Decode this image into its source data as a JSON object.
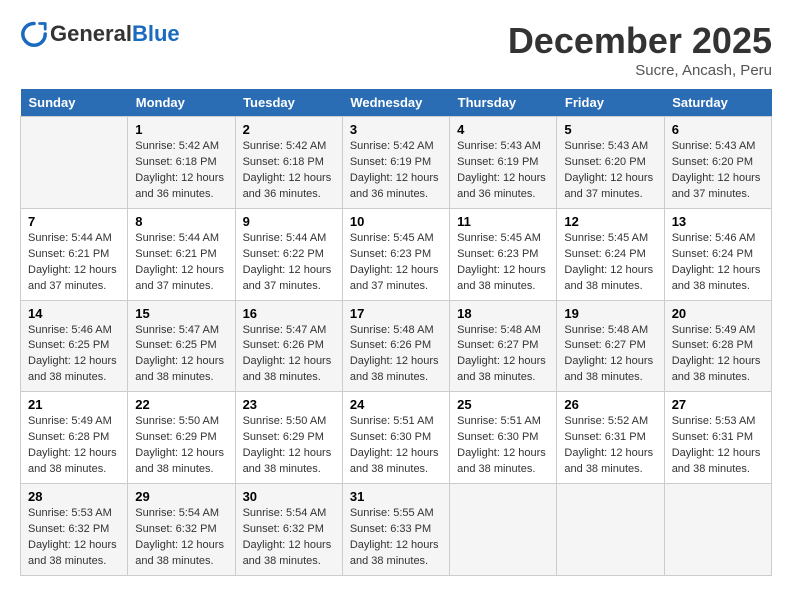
{
  "header": {
    "logo_line1": "General",
    "logo_line2": "Blue",
    "month_title": "December 2025",
    "location": "Sucre, Ancash, Peru"
  },
  "days_of_week": [
    "Sunday",
    "Monday",
    "Tuesday",
    "Wednesday",
    "Thursday",
    "Friday",
    "Saturday"
  ],
  "weeks": [
    [
      {
        "day": "",
        "info": ""
      },
      {
        "day": "1",
        "info": "Sunrise: 5:42 AM\nSunset: 6:18 PM\nDaylight: 12 hours\nand 36 minutes."
      },
      {
        "day": "2",
        "info": "Sunrise: 5:42 AM\nSunset: 6:18 PM\nDaylight: 12 hours\nand 36 minutes."
      },
      {
        "day": "3",
        "info": "Sunrise: 5:42 AM\nSunset: 6:19 PM\nDaylight: 12 hours\nand 36 minutes."
      },
      {
        "day": "4",
        "info": "Sunrise: 5:43 AM\nSunset: 6:19 PM\nDaylight: 12 hours\nand 36 minutes."
      },
      {
        "day": "5",
        "info": "Sunrise: 5:43 AM\nSunset: 6:20 PM\nDaylight: 12 hours\nand 37 minutes."
      },
      {
        "day": "6",
        "info": "Sunrise: 5:43 AM\nSunset: 6:20 PM\nDaylight: 12 hours\nand 37 minutes."
      }
    ],
    [
      {
        "day": "7",
        "info": "Sunrise: 5:44 AM\nSunset: 6:21 PM\nDaylight: 12 hours\nand 37 minutes."
      },
      {
        "day": "8",
        "info": "Sunrise: 5:44 AM\nSunset: 6:21 PM\nDaylight: 12 hours\nand 37 minutes."
      },
      {
        "day": "9",
        "info": "Sunrise: 5:44 AM\nSunset: 6:22 PM\nDaylight: 12 hours\nand 37 minutes."
      },
      {
        "day": "10",
        "info": "Sunrise: 5:45 AM\nSunset: 6:23 PM\nDaylight: 12 hours\nand 37 minutes."
      },
      {
        "day": "11",
        "info": "Sunrise: 5:45 AM\nSunset: 6:23 PM\nDaylight: 12 hours\nand 38 minutes."
      },
      {
        "day": "12",
        "info": "Sunrise: 5:45 AM\nSunset: 6:24 PM\nDaylight: 12 hours\nand 38 minutes."
      },
      {
        "day": "13",
        "info": "Sunrise: 5:46 AM\nSunset: 6:24 PM\nDaylight: 12 hours\nand 38 minutes."
      }
    ],
    [
      {
        "day": "14",
        "info": "Sunrise: 5:46 AM\nSunset: 6:25 PM\nDaylight: 12 hours\nand 38 minutes."
      },
      {
        "day": "15",
        "info": "Sunrise: 5:47 AM\nSunset: 6:25 PM\nDaylight: 12 hours\nand 38 minutes."
      },
      {
        "day": "16",
        "info": "Sunrise: 5:47 AM\nSunset: 6:26 PM\nDaylight: 12 hours\nand 38 minutes."
      },
      {
        "day": "17",
        "info": "Sunrise: 5:48 AM\nSunset: 6:26 PM\nDaylight: 12 hours\nand 38 minutes."
      },
      {
        "day": "18",
        "info": "Sunrise: 5:48 AM\nSunset: 6:27 PM\nDaylight: 12 hours\nand 38 minutes."
      },
      {
        "day": "19",
        "info": "Sunrise: 5:48 AM\nSunset: 6:27 PM\nDaylight: 12 hours\nand 38 minutes."
      },
      {
        "day": "20",
        "info": "Sunrise: 5:49 AM\nSunset: 6:28 PM\nDaylight: 12 hours\nand 38 minutes."
      }
    ],
    [
      {
        "day": "21",
        "info": "Sunrise: 5:49 AM\nSunset: 6:28 PM\nDaylight: 12 hours\nand 38 minutes."
      },
      {
        "day": "22",
        "info": "Sunrise: 5:50 AM\nSunset: 6:29 PM\nDaylight: 12 hours\nand 38 minutes."
      },
      {
        "day": "23",
        "info": "Sunrise: 5:50 AM\nSunset: 6:29 PM\nDaylight: 12 hours\nand 38 minutes."
      },
      {
        "day": "24",
        "info": "Sunrise: 5:51 AM\nSunset: 6:30 PM\nDaylight: 12 hours\nand 38 minutes."
      },
      {
        "day": "25",
        "info": "Sunrise: 5:51 AM\nSunset: 6:30 PM\nDaylight: 12 hours\nand 38 minutes."
      },
      {
        "day": "26",
        "info": "Sunrise: 5:52 AM\nSunset: 6:31 PM\nDaylight: 12 hours\nand 38 minutes."
      },
      {
        "day": "27",
        "info": "Sunrise: 5:53 AM\nSunset: 6:31 PM\nDaylight: 12 hours\nand 38 minutes."
      }
    ],
    [
      {
        "day": "28",
        "info": "Sunrise: 5:53 AM\nSunset: 6:32 PM\nDaylight: 12 hours\nand 38 minutes."
      },
      {
        "day": "29",
        "info": "Sunrise: 5:54 AM\nSunset: 6:32 PM\nDaylight: 12 hours\nand 38 minutes."
      },
      {
        "day": "30",
        "info": "Sunrise: 5:54 AM\nSunset: 6:32 PM\nDaylight: 12 hours\nand 38 minutes."
      },
      {
        "day": "31",
        "info": "Sunrise: 5:55 AM\nSunset: 6:33 PM\nDaylight: 12 hours\nand 38 minutes."
      },
      {
        "day": "",
        "info": ""
      },
      {
        "day": "",
        "info": ""
      },
      {
        "day": "",
        "info": ""
      }
    ]
  ]
}
